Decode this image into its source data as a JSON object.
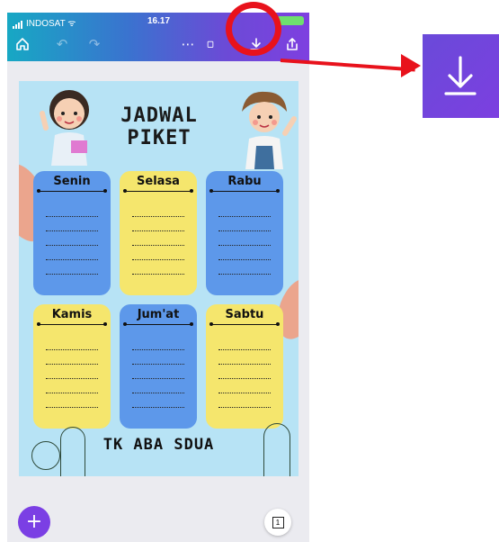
{
  "status_bar": {
    "carrier": "INDOSAT",
    "time": "16.17"
  },
  "toolbar": {
    "home_icon": "home-icon",
    "undo_icon": "undo-icon",
    "redo_icon": "redo-icon",
    "more_icon": "more-icon",
    "download_icon": "download-icon",
    "share_icon": "share-icon"
  },
  "design": {
    "title_line1": "JADWAL",
    "title_line2": "PIKET",
    "days": [
      {
        "label": "Senin",
        "color": "#5d98ea"
      },
      {
        "label": "Selasa",
        "color": "#f5e66d"
      },
      {
        "label": "Rabu",
        "color": "#5d98ea"
      },
      {
        "label": "Kamis",
        "color": "#f5e66d"
      },
      {
        "label": "Jum'at",
        "color": "#5d98ea"
      },
      {
        "label": "Sabtu",
        "color": "#f5e66d"
      }
    ],
    "footer": "TK ABA SDUA",
    "background_color": "#b7e3f5"
  },
  "bottom": {
    "add_label": "+",
    "page_count": "1"
  },
  "highlight": {
    "ring_color": "#e8121c",
    "zoomed_icon": "download-icon",
    "zoom_bg": "#7c3fe0"
  }
}
